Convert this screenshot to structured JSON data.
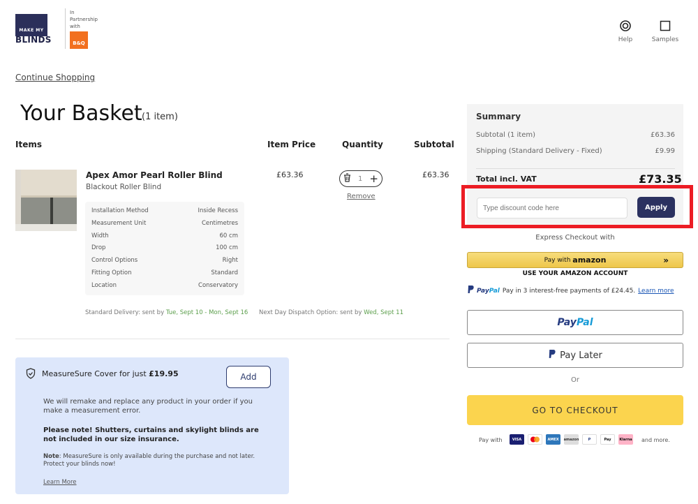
{
  "header": {
    "logo_top": "MAKE MY",
    "logo_bottom": "BLINDS",
    "partner_line1": "In",
    "partner_line2": "Partnership",
    "partner_line3": "with",
    "partner_brand": "B&Q",
    "help_label": "Help",
    "samples_label": "Samples"
  },
  "continue_shopping": "Continue Shopping",
  "basket": {
    "title": "Your Basket",
    "count": "(1 item)",
    "col_items": "Items",
    "col_price": "Item Price",
    "col_qty": "Quantity",
    "col_subtotal": "Subtotal"
  },
  "product": {
    "name": "Apex Amor Pearl Roller Blind",
    "subtitle": "Blackout Roller Blind",
    "price": "£63.36",
    "quantity": "1",
    "subtotal": "£63.36",
    "remove_label": "Remove",
    "specs": [
      {
        "label": "Installation Method",
        "value": "Inside Recess"
      },
      {
        "label": "Measurement Unit",
        "value": "Centimetres"
      },
      {
        "label": "Width",
        "value": "60 cm"
      },
      {
        "label": "Drop",
        "value": "100 cm"
      },
      {
        "label": "Control Options",
        "value": "Right"
      },
      {
        "label": "Fitting Option",
        "value": "Standard"
      },
      {
        "label": "Location",
        "value": "Conservatory"
      }
    ]
  },
  "delivery": {
    "standard_prefix": "Standard Delivery: sent by ",
    "standard_dates": "Tue, Sept 10 - Mon, Sept 16",
    "nextday_prefix": "Next Day Dispatch Option: sent by ",
    "nextday_date": "Wed, Sept 11"
  },
  "measuresure": {
    "title_prefix": "MeasureSure Cover for just ",
    "price": "£19.95",
    "add_label": "Add",
    "para1": "We will remake and replace any product in your order if you make a measurement error.",
    "para2": "Please note! Shutters, curtains and skylight blinds are not included in our size insurance.",
    "note_label": "Note",
    "note_text": ": MeasureSure is only available during the purchase and not later. Protect your blinds now!",
    "learn_more": "Learn More"
  },
  "summary": {
    "title": "Summary",
    "subtotal_label": "Subtotal (1 item)",
    "subtotal_value": "£63.36",
    "shipping_label": "Shipping (Standard Delivery - Fixed)",
    "shipping_value": "£9.99",
    "total_label": "Total incl. VAT",
    "total_value": "£73.35",
    "discount_placeholder": "Type discount code here",
    "apply_label": "Apply"
  },
  "express": {
    "label": "Express Checkout with",
    "amazon_prefix": "Pay with",
    "amazon_brand": "amazon",
    "amazon_sub": "USE YOUR AMAZON ACCOUNT",
    "paypal_brand_a": "Pay",
    "paypal_brand_b": "Pal",
    "paypal_installments": "Pay in 3 interest-free payments of £24.45.",
    "paypal_learn": "Learn more",
    "pay_later": "Pay Later",
    "or": "Or",
    "checkout": "GO TO CHECKOUT",
    "pay_with": "Pay with",
    "and_more": "and more."
  },
  "payment_cards": [
    {
      "name": "VISA",
      "color": "#1a1f71"
    },
    {
      "name": "MC",
      "color": "#f79e1b"
    },
    {
      "name": "AMEX",
      "color": "#2e77bb"
    },
    {
      "name": "amazon",
      "color": "#cccccc"
    },
    {
      "name": "P",
      "color": "#ffffff"
    },
    {
      "name": "Pay",
      "color": "#ffffff"
    },
    {
      "name": "Klarna",
      "color": "#ffb3c7"
    }
  ]
}
